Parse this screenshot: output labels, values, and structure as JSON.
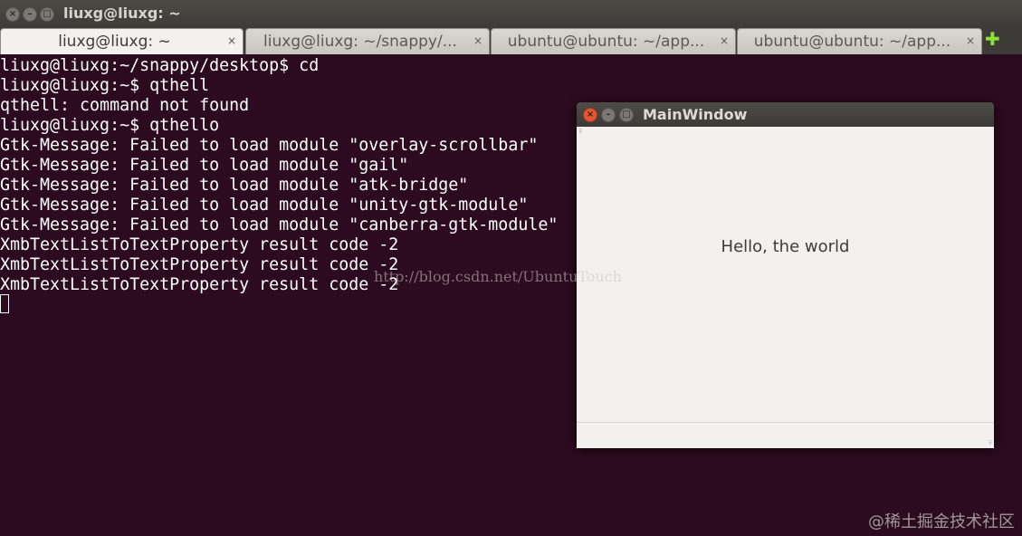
{
  "terminal_window": {
    "title": "liuxg@liuxg: ~",
    "buttons": {
      "close": "×",
      "minimize": "–",
      "maximize": "□"
    }
  },
  "tabs": [
    {
      "label": "liuxg@liuxg: ~",
      "close": "×",
      "active": true
    },
    {
      "label": "liuxg@liuxg: ~/snappy/...",
      "close": "×",
      "active": false
    },
    {
      "label": "ubuntu@ubuntu: ~/app...",
      "close": "×",
      "active": false
    },
    {
      "label": "ubuntu@ubuntu: ~/app...",
      "close": "×",
      "active": false
    }
  ],
  "new_tab_icon": "✚",
  "terminal_lines": [
    "liuxg@liuxg:~/snappy/desktop$ cd",
    "liuxg@liuxg:~$ qthell",
    "qthell: command not found",
    "liuxg@liuxg:~$ qthello",
    "Gtk-Message: Failed to load module \"overlay-scrollbar\"",
    "Gtk-Message: Failed to load module \"gail\"",
    "Gtk-Message: Failed to load module \"atk-bridge\"",
    "Gtk-Message: Failed to load module \"unity-gtk-module\"",
    "Gtk-Message: Failed to load module \"canberra-gtk-module\"",
    "XmbTextListToTextProperty result code -2",
    "XmbTextListToTextProperty result code -2",
    "XmbTextListToTextProperty result code -2"
  ],
  "main_window": {
    "title": "MainWindow",
    "label": "Hello, the world",
    "buttons": {
      "close": "×",
      "minimize": "–",
      "maximize": "□"
    }
  },
  "watermark": "http://blog.csdn.net/UbuntuTouch",
  "corner_watermark": "@稀土掘金技术社区",
  "colors": {
    "terminal_bg": "#2c0a1f",
    "titlebar_bg": "#3c3b37",
    "close_button": "#e2582c",
    "new_tab_icon": "#8ae234"
  }
}
